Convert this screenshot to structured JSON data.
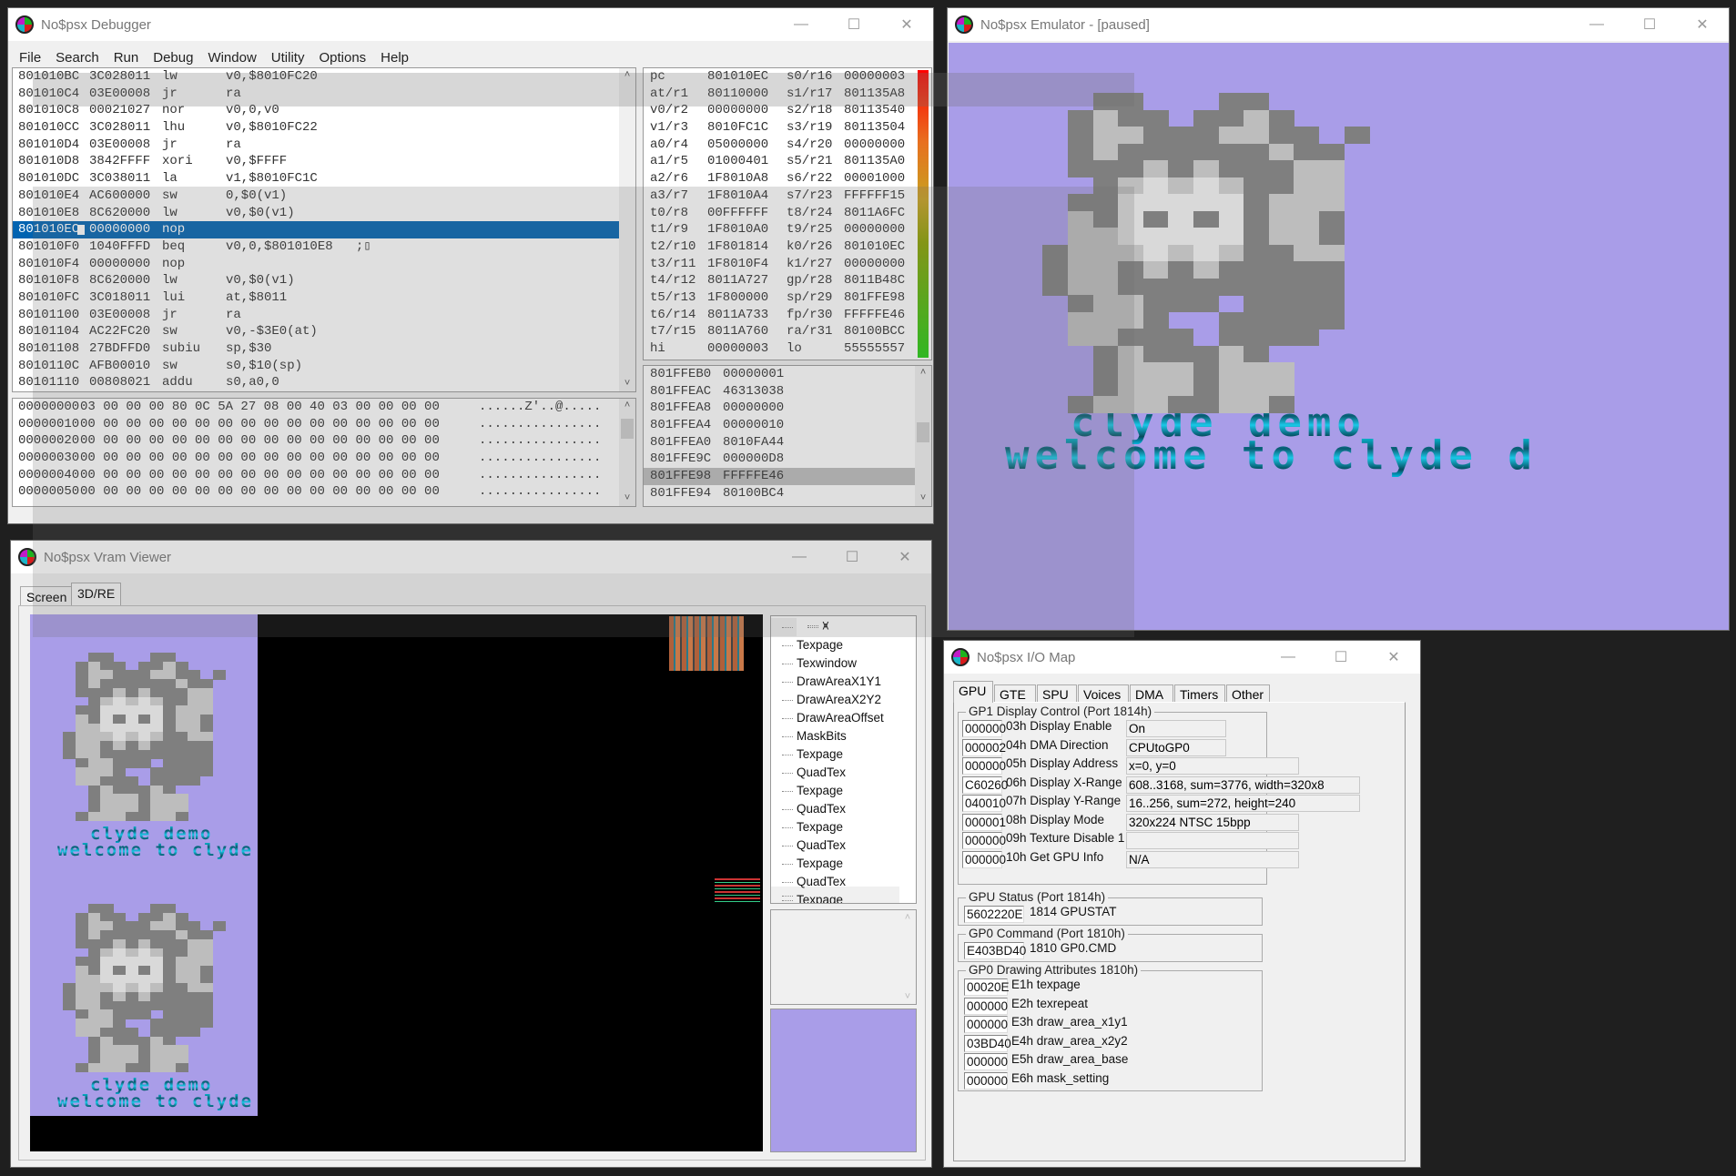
{
  "debugger": {
    "title": "No$psx Debugger",
    "menu": [
      "File",
      "Search",
      "Run",
      "Debug",
      "Window",
      "Utility",
      "Options",
      "Help"
    ],
    "disasm": [
      [
        "801010BC",
        "3C028011",
        "lw",
        "v0,$8010FC20"
      ],
      [
        "801010C4",
        "03E00008",
        "jr",
        "ra"
      ],
      [
        "801010C8",
        "00021027",
        "nor",
        "v0,0,v0"
      ],
      [
        "801010CC",
        "3C028011",
        "lhu",
        "v0,$8010FC22"
      ],
      [
        "801010D4",
        "03E00008",
        "jr",
        "ra"
      ],
      [
        "801010D8",
        "3842FFFF",
        "xori",
        "v0,$FFFF"
      ],
      [
        "801010DC",
        "3C038011",
        "la",
        "v1,$8010FC1C"
      ],
      [
        "801010E4",
        "AC600000",
        "sw",
        "0,$0(v1)"
      ],
      [
        "801010E8",
        "8C620000",
        "lw",
        "v0,$0(v1)"
      ],
      [
        "801010EC",
        "00000000",
        "nop",
        ""
      ],
      [
        "801010F0",
        "1040FFFD",
        "beq",
        "v0,0,$801010E8   ;▯"
      ],
      [
        "801010F4",
        "00000000",
        "nop",
        ""
      ],
      [
        "801010F8",
        "8C620000",
        "lw",
        "v0,$0(v1)"
      ],
      [
        "801010FC",
        "3C018011",
        "lui",
        "at,$8011"
      ],
      [
        "80101100",
        "03E00008",
        "jr",
        "ra"
      ],
      [
        "80101104",
        "AC22FC20",
        "sw",
        "v0,-$3E0(at)"
      ],
      [
        "80101108",
        "27BDFFD0",
        "subiu",
        "sp,$30"
      ],
      [
        "8010110C",
        "AFB00010",
        "sw",
        "s0,$10(sp)"
      ],
      [
        "80101110",
        "00808021",
        "addu",
        "s0,a0,0"
      ]
    ],
    "selected_row": 9,
    "registers": [
      [
        "pc",
        "801010EC",
        "s0/r16",
        "00000003"
      ],
      [
        "at/r1",
        "80110000",
        "s1/r17",
        "801135A8"
      ],
      [
        "v0/r2",
        "00000000",
        "s2/r18",
        "80113540"
      ],
      [
        "v1/r3",
        "8010FC1C",
        "s3/r19",
        "80113504"
      ],
      [
        "a0/r4",
        "05000000",
        "s4/r20",
        "00000000"
      ],
      [
        "a1/r5",
        "01000401",
        "s5/r21",
        "801135A0"
      ],
      [
        "a2/r6",
        "1F8010A8",
        "s6/r22",
        "00001000"
      ],
      [
        "a3/r7",
        "1F8010A4",
        "s7/r23",
        "FFFFFF15"
      ],
      [
        "t0/r8",
        "00FFFFFF",
        "t8/r24",
        "8011A6FC"
      ],
      [
        "t1/r9",
        "1F8010A0",
        "t9/r25",
        "00000000"
      ],
      [
        "t2/r10",
        "1F801814",
        "k0/r26",
        "801010EC"
      ],
      [
        "t3/r11",
        "1F8010F4",
        "k1/r27",
        "00000000"
      ],
      [
        "t4/r12",
        "8011A727",
        "gp/r28",
        "8011B48C"
      ],
      [
        "t5/r13",
        "1F800000",
        "sp/r29",
        "801FFE98"
      ],
      [
        "t6/r14",
        "8011A733",
        "fp/r30",
        "FFFFFE46"
      ],
      [
        "t7/r15",
        "8011A760",
        "ra/r31",
        "80100BCC"
      ],
      [
        "hi",
        "00000003",
        "lo",
        "55555557"
      ]
    ],
    "memory": [
      [
        "00000000",
        "03 00 00 00 80 0C 5A 27 08 00 40 03 00 00 00 00",
        "......Z'..@....."
      ],
      [
        "00000010",
        "00 00 00 00 00 00 00 00 00 00 00 00 00 00 00 00",
        "................"
      ],
      [
        "00000020",
        "00 00 00 00 00 00 00 00 00 00 00 00 00 00 00 00",
        "................"
      ],
      [
        "00000030",
        "00 00 00 00 00 00 00 00 00 00 00 00 00 00 00 00",
        "................"
      ],
      [
        "00000040",
        "00 00 00 00 00 00 00 00 00 00 00 00 00 00 00 00",
        "................"
      ],
      [
        "00000050",
        "00 00 00 00 00 00 00 00 00 00 00 00 00 00 00 00",
        "................"
      ]
    ],
    "stack": [
      [
        "801FFEB0",
        "00000001"
      ],
      [
        "801FFEAC",
        "46313038"
      ],
      [
        "801FFEA8",
        "00000000"
      ],
      [
        "801FFEA4",
        "00000010"
      ],
      [
        "801FFEA0",
        "8010FA44"
      ],
      [
        "801FFE9C",
        "000000D8"
      ],
      [
        "801FFE98",
        "FFFFFE46"
      ],
      [
        "801FFE94",
        "80100BC4"
      ]
    ],
    "stack_selected": 6
  },
  "emulator": {
    "title": "No$psx Emulator - [paused]",
    "screen_text": [
      "clyde demo",
      "welcome to clyde d"
    ],
    "bg_color": "#a99de8"
  },
  "vram": {
    "title": "No$psx Vram Viewer",
    "tabs": [
      "Screen",
      "3D/RE"
    ],
    "active_tab": "3D/RE",
    "screen_text": [
      "clyde demo",
      "welcome to clyde"
    ],
    "commands": [
      "Texpage",
      "Texwindow",
      "DrawAreaX1Y1",
      "DrawAreaX2Y2",
      "DrawAreaOffset",
      "MaskBits",
      "Texpage",
      "QuadTex",
      "Texpage",
      "QuadTex",
      "Texpage",
      "QuadTex",
      "Texpage",
      "QuadTex",
      "Texpage"
    ]
  },
  "iomap": {
    "title": "No$psx I/O Map",
    "tabs": [
      "GPU",
      "GTE",
      "SPU",
      "Voices",
      "DMA",
      "Timers",
      "Other"
    ],
    "active_tab": "GPU",
    "gp1": {
      "label": "GP1 Display Control (Port 1814h)",
      "rows": [
        [
          "000000",
          "03h Display Enable",
          "On"
        ],
        [
          "000002",
          "04h DMA Direction",
          "CPUtoGP0"
        ],
        [
          "000000",
          "05h Display Address",
          "x=0, y=0"
        ],
        [
          "C60260",
          "06h Display X-Range",
          "608..3168, sum=3776, width=320x8"
        ],
        [
          "040010",
          "07h Display Y-Range",
          "16..256, sum=272, height=240"
        ],
        [
          "000001",
          "08h Display Mode",
          "320x224 NTSC 15bpp"
        ],
        [
          "000000",
          "09h Texture Disable 1",
          ""
        ],
        [
          "000000",
          "10h Get GPU Info",
          "N/A"
        ]
      ]
    },
    "status": {
      "label": "GPU Status (Port 1814h)",
      "value": "5602220E",
      "name": "1814 GPUSTAT"
    },
    "command": {
      "label": "GP0 Command (Port 1810h)",
      "value": "E403BD40",
      "name": "1810 GP0.CMD"
    },
    "attrs": {
      "label": "GP0 Drawing Attributes 1810h)",
      "rows": [
        [
          "00020E",
          "E1h texpage"
        ],
        [
          "000000",
          "E2h texrepeat"
        ],
        [
          "000000",
          "E3h draw_area_x1y1"
        ],
        [
          "03BD40",
          "E4h draw_area_x2y2"
        ],
        [
          "000000",
          "E5h draw_area_base"
        ],
        [
          "000000",
          "E6h mask_setting"
        ]
      ]
    }
  },
  "window_controls": {
    "minimize": "—",
    "maximize": "☐",
    "close": "✕"
  }
}
